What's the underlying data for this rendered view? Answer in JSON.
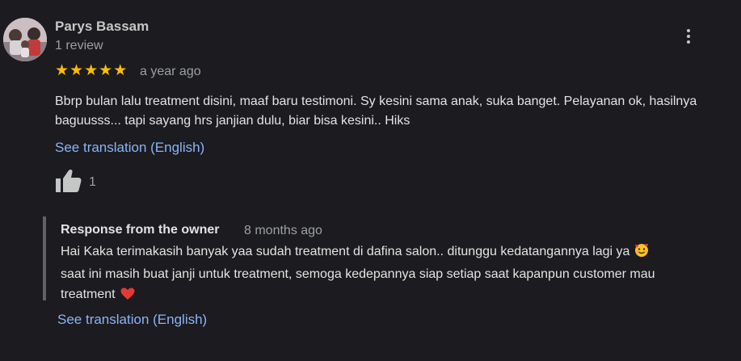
{
  "reviewer": {
    "name": "Parys Bassam",
    "review_count": "1 review"
  },
  "review": {
    "rating": 5,
    "stars": [
      "★",
      "★",
      "★",
      "★",
      "★"
    ],
    "date": "a year ago",
    "text": "Bbrp bulan lalu treatment disini, maaf baru testimoni. Sy kesini sama anak, suka banget. Pelayanan ok, hasilnya baguusss... tapi sayang hrs janjian dulu, biar bisa kesini.. Hiks",
    "translation_link": "See translation (English)",
    "like_count": "1"
  },
  "owner_response": {
    "title": "Response from the owner",
    "date": "8 months ago",
    "line1": "Hai Kaka terimakasih banyak yaa sudah treatment di dafina salon.. ditunggu kedatangannya lagi ya",
    "line2": "saat ini masih buat janji untuk treatment, semoga kedepannya siap setiap saat kapanpun customer mau",
    "line3": "treatment",
    "translation_link": "See translation (English)"
  },
  "colors": {
    "background": "#1c1b1f",
    "star": "#fbbc04",
    "link": "#8ab4f8",
    "heart": "#e53935"
  },
  "icons": [
    "more-vert-icon",
    "thumbs-up-icon",
    "smiling-face-with-hearts-icon",
    "red-heart-icon"
  ]
}
